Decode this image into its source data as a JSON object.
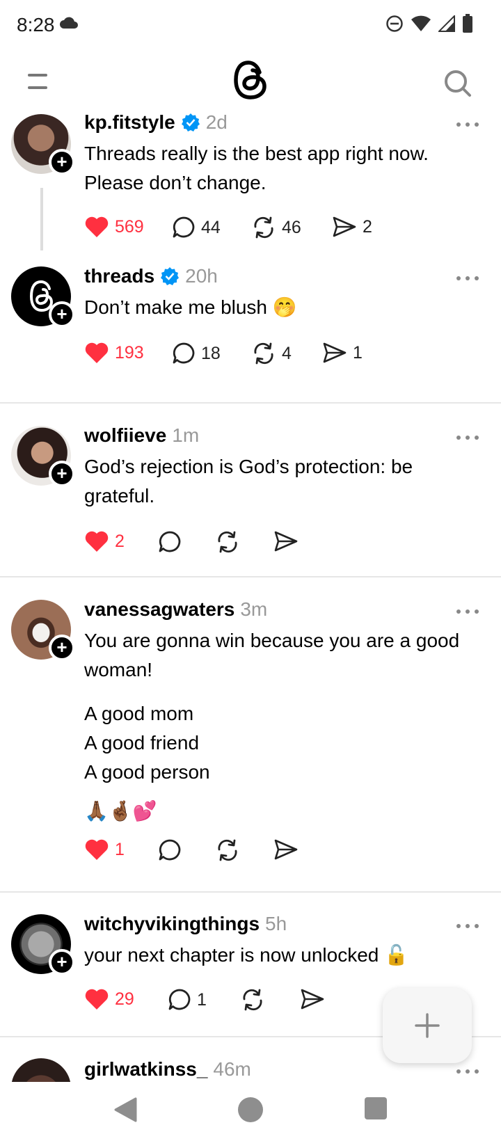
{
  "status_bar": {
    "time": "8:28"
  },
  "posts": [
    {
      "username": "kp.fitstyle",
      "time": "2d",
      "verified": true,
      "text": "Threads really is the best app right now. Please don’t change.",
      "likes": "569",
      "replies": "44",
      "reposts": "46",
      "shares": "2"
    },
    {
      "username": "threads",
      "time": "20h",
      "verified": true,
      "text": "Don’t make me blush 🤭",
      "likes": "193",
      "replies": "18",
      "reposts": "4",
      "shares": "1"
    },
    {
      "username": "wolfiieve",
      "time": "1m",
      "text": "God’s rejection is God’s protection: be grateful.",
      "likes": "2"
    },
    {
      "username": "vanessagwaters",
      "time": "3m",
      "text": "You are gonna win because you are a good woman!",
      "lines": [
        "A good mom",
        "A good friend",
        "A good person"
      ],
      "emojis": "🙏🏾🤞🏾💕",
      "likes": "1"
    },
    {
      "username": "witchyvikingthings",
      "time": "5h",
      "text": "your next chapter is now unlocked 🔓",
      "likes": "29",
      "replies": "1"
    },
    {
      "username": "girlwatkinss_",
      "time": "46m"
    }
  ],
  "colors": {
    "like": "#ff3040",
    "verified": "#0095f6",
    "muted": "#999999"
  }
}
